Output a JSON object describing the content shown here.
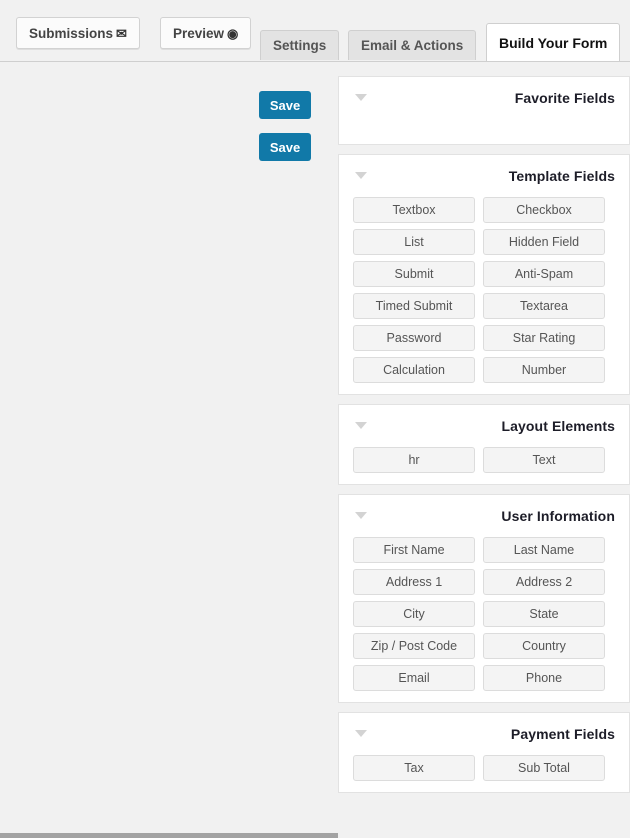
{
  "tabs": [
    {
      "label": "Submissions",
      "icon": "envelope-icon",
      "glyph": "✉",
      "style": "outlined",
      "active": false
    },
    {
      "label": "Preview",
      "icon": "eye-icon",
      "glyph": "◉",
      "style": "outlined",
      "active": false
    },
    {
      "label": "Settings",
      "icon": null,
      "glyph": null,
      "style": "plain",
      "active": false
    },
    {
      "label": "Email & Actions",
      "icon": null,
      "glyph": null,
      "style": "plain",
      "active": false
    },
    {
      "label": "Build Your Form",
      "icon": null,
      "glyph": null,
      "style": "plain",
      "active": true
    }
  ],
  "toolbar": {
    "save_label_top": "Save",
    "save_label_bottom": "Save"
  },
  "colors": {
    "save_button": "#1179a8",
    "page_background": "#f1f1f1",
    "panel_background": "#ffffff",
    "field_button": "#f4f4f4",
    "arrow": "#d3d3d3"
  },
  "panels": [
    {
      "title": "Favorite Fields",
      "arrow_icon": "chevron-down-icon",
      "fields": []
    },
    {
      "title": "Template Fields",
      "arrow_icon": "chevron-down-icon",
      "fields": [
        "Textbox",
        "Checkbox",
        "List",
        "Hidden Field",
        "Submit",
        "Anti-Spam",
        "Timed Submit",
        "Textarea",
        "Password",
        "Star Rating",
        "Calculation",
        "Number"
      ]
    },
    {
      "title": "Layout Elements",
      "arrow_icon": "chevron-down-icon",
      "fields": [
        "hr",
        "Text"
      ]
    },
    {
      "title": "User Information",
      "arrow_icon": "chevron-down-icon",
      "fields": [
        "First Name",
        "Last Name",
        "Address 1",
        "Address 2",
        "City",
        "State",
        "Zip / Post Code",
        "Country",
        "Email",
        "Phone"
      ]
    },
    {
      "title": "Payment Fields",
      "arrow_icon": "chevron-down-icon",
      "fields": [
        "Tax",
        "Sub Total"
      ]
    }
  ]
}
